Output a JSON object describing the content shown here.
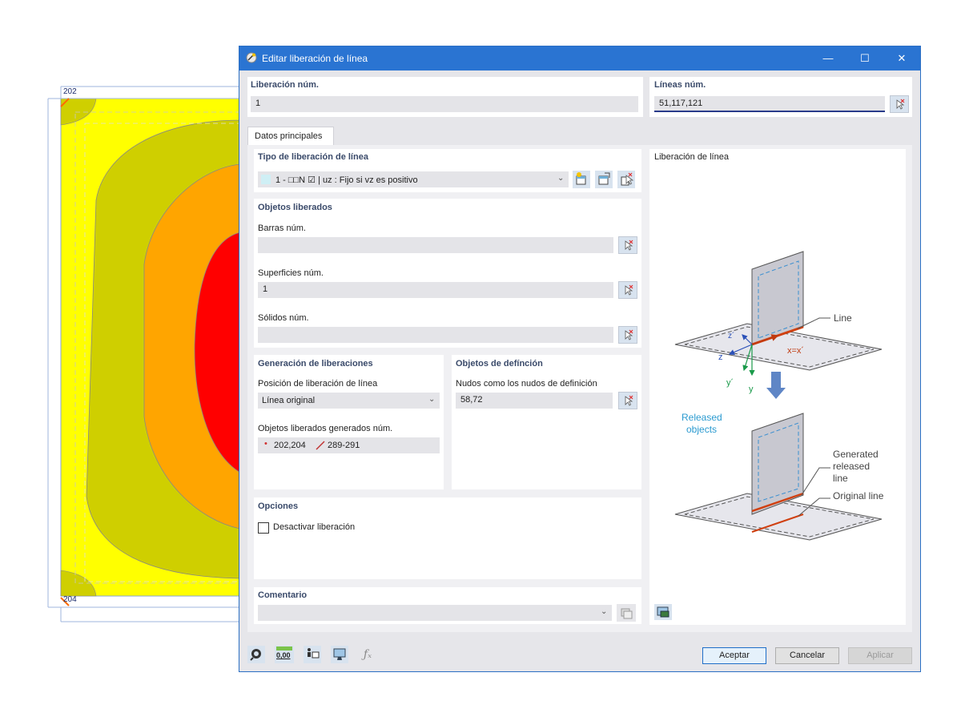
{
  "background": {
    "node_labels": [
      "202",
      "204"
    ],
    "colors": {
      "outer_yellow": "#ffff00",
      "olive": "#d4d000",
      "orange": "#ffa500",
      "red": "#ff0000"
    }
  },
  "dialog": {
    "title": "Editar liberación de línea",
    "window_controls": {
      "minimize": "—",
      "maximize": "☐",
      "close": "✕"
    },
    "release_no": {
      "label": "Liberación núm.",
      "value": "1"
    },
    "lines_no": {
      "label": "Líneas núm.",
      "value": "51,117,121"
    },
    "tabs": [
      {
        "label": "Datos principales"
      }
    ],
    "release_type": {
      "heading": "Tipo de liberación de línea",
      "selected": "1 - □□N ☑ | uz : Fijo si vz es positivo"
    },
    "released_objects": {
      "heading": "Objetos liberados",
      "members": {
        "label": "Barras núm.",
        "value": ""
      },
      "surfaces": {
        "label": "Superficies núm.",
        "value": "1"
      },
      "solids": {
        "label": "Sólidos núm.",
        "value": ""
      }
    },
    "generation": {
      "heading": "Generación de liberaciones",
      "position_label": "Posición de liberación de línea",
      "position_value": "Línea original",
      "generated_label": "Objetos liberados generados núm.",
      "generated_nodes": "202,204",
      "generated_lines": "289-291"
    },
    "definition_objects": {
      "heading": "Objetos de defínción",
      "nodes_label": "Nudos como los nudos de definición",
      "nodes_value": "58,72"
    },
    "options": {
      "heading": "Opciones",
      "deactivate_label": "Desactivar liberación",
      "deactivate_checked": false
    },
    "comment": {
      "heading": "Comentario",
      "value": ""
    },
    "diagram": {
      "heading": "Liberación de línea",
      "labels": {
        "line": "Line",
        "z_prime": "z´",
        "x_axis": "x=x´",
        "z": "z",
        "y_prime": "y´",
        "y": "y",
        "released_objects_1": "Released",
        "released_objects_2": "objects",
        "generated_1": "Generated",
        "generated_2": "released",
        "generated_3": "line",
        "original_line": "Original line"
      }
    },
    "footer": {
      "accept": "Aceptar",
      "cancel": "Cancelar",
      "apply": "Aplicar",
      "units_icon_text": "0,00"
    }
  }
}
